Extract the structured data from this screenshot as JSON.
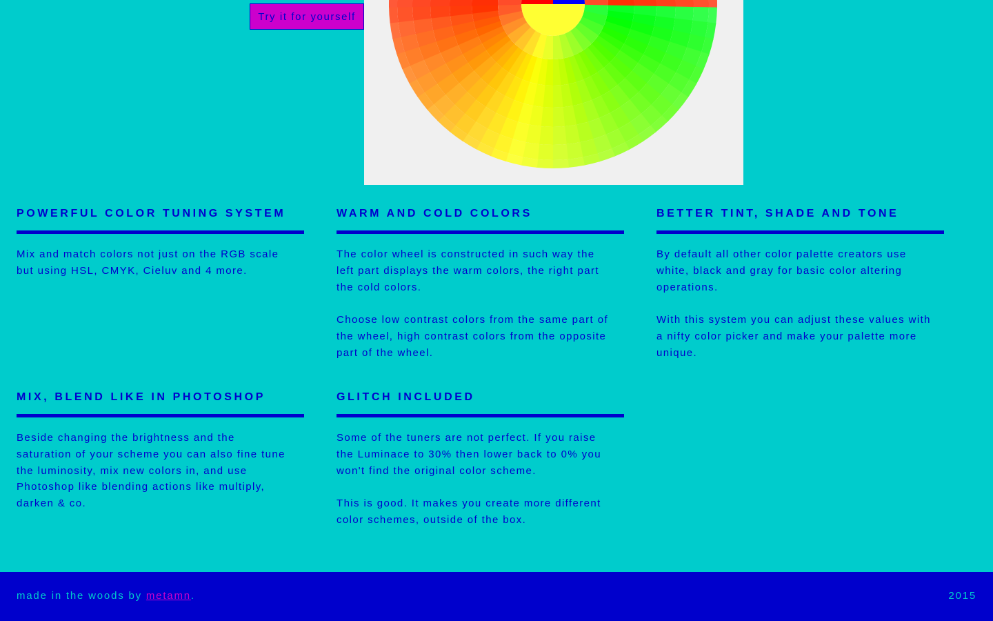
{
  "hero": {
    "try_button": "Try it for yourself"
  },
  "features": [
    {
      "title": "POWERFUL COLOR TUNING SYSTEM",
      "paragraphs": [
        "Mix and match colors not just on the RGB scale but using HSL, CMYK, Cieluv and 4 more."
      ]
    },
    {
      "title": "WARM AND COLD COLORS",
      "paragraphs": [
        "The color wheel is constructed in such way the left part displays the warm colors, the right part the cold colors.",
        "Choose low contrast colors from the same part of the wheel, high contrast colors from the opposite part of the wheel."
      ]
    },
    {
      "title": "BETTER TINT, SHADE AND TONE",
      "paragraphs": [
        "By default all other color palette creators use white, black and gray for basic color altering operations.",
        "With this system you can adjust these values with a nifty color picker and make your palette more unique."
      ]
    },
    {
      "title": "MIX, BLEND LIKE IN PHOTOSHOP",
      "paragraphs": [
        "Beside changing the brightness and the saturation of your scheme you can also fine tune the luminosity, mix new colors in, and use Photoshop like blending actions like multiply, darken & co."
      ]
    },
    {
      "title": "GLITCH INCLUDED",
      "paragraphs": [
        "Some of the tuners are not perfect. If you raise the Luminace to 30% then lower back to 0% you won't find the original color scheme.",
        "This is good. It makes you create more different color schemes, outside of the box."
      ]
    }
  ],
  "footer": {
    "made_prefix": "made in the woods by ",
    "author_link": "metamn",
    "made_suffix": ".",
    "year": "2015"
  },
  "colors": {
    "background": "#00cccc",
    "text": "#0000cc",
    "accent": "#cc00cc",
    "panel": "#f0f0f0"
  }
}
